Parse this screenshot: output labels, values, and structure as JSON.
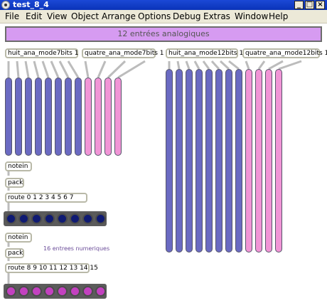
{
  "window": {
    "title": "test_8_4",
    "minimize_glyph": "_",
    "maximize_glyph": "□",
    "close_glyph": "×"
  },
  "menu": [
    "File",
    "Edit",
    "View",
    "Object",
    "Arrange",
    "Options",
    "Debug",
    "Extras",
    "Window",
    "Help"
  ],
  "patch": {
    "banner": "12 entrées analogiques",
    "objects": {
      "huit7": "huit_ana_mode7bits 1",
      "quatre7": "quatre_ana_mode7bits 1",
      "huit12": "huit_ana_mode12bits 1",
      "quatre12": "quatre_ana_mode12bits 1",
      "notein1": "notein",
      "pack1": "pack",
      "route1": "route 0 1 2 3 4 5 6 7",
      "notein2": "notein",
      "pack2": "pack",
      "route2": "route 8 9 10 11 12 13 14 15"
    },
    "comment": "16 entrees numeriques"
  },
  "colors": {
    "slider_blue": "#6a6ac2",
    "slider_pink": "#f195d6",
    "led_row1": "#0f1a72",
    "led_row2": "#c341c0",
    "banner": "#d69bf1"
  }
}
